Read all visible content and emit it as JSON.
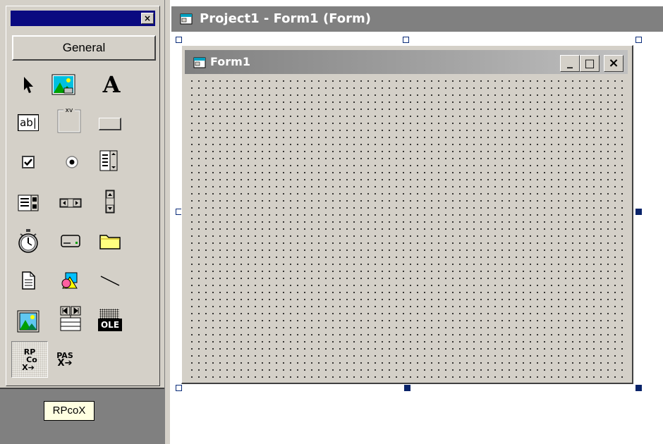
{
  "toolbox": {
    "close_glyph": "×",
    "tab_label": "General",
    "tools": [
      {
        "name": "pointer"
      },
      {
        "name": "picturebox"
      },
      {
        "name": "label",
        "glyph": "A"
      },
      {
        "name": "textbox",
        "glyph": "ab|"
      },
      {
        "name": "frame",
        "glyph": "xv"
      },
      {
        "name": "commandbutton"
      },
      {
        "name": "checkbox"
      },
      {
        "name": "optionbutton"
      },
      {
        "name": "combobox"
      },
      {
        "name": "listbox"
      },
      {
        "name": "hscrollbar"
      },
      {
        "name": "vscrollbar"
      },
      {
        "name": "timer"
      },
      {
        "name": "drivelistbox"
      },
      {
        "name": "dirlistbox"
      },
      {
        "name": "filelistbox"
      },
      {
        "name": "shape"
      },
      {
        "name": "line"
      },
      {
        "name": "image"
      },
      {
        "name": "data"
      },
      {
        "name": "ole",
        "glyph": "OLE"
      },
      {
        "name": "rpcox",
        "glyph_top": "RP",
        "glyph_mid": "Co",
        "glyph_bottom": "X"
      },
      {
        "name": "pasx",
        "glyph_top": "PAS",
        "glyph_bottom": "X"
      }
    ],
    "tooltip": "RPcoX"
  },
  "designer": {
    "title": "Project1 - Form1 (Form)"
  },
  "form": {
    "title": "Form1",
    "min_glyph": "_",
    "max_glyph": "□",
    "close_glyph": "×"
  },
  "colors": {
    "face": "#d4d0c8",
    "active_title": "#0a0a80",
    "inactive_title": "#808080",
    "tooltip_bg": "#ffffe1",
    "handle": "#0a246a"
  }
}
